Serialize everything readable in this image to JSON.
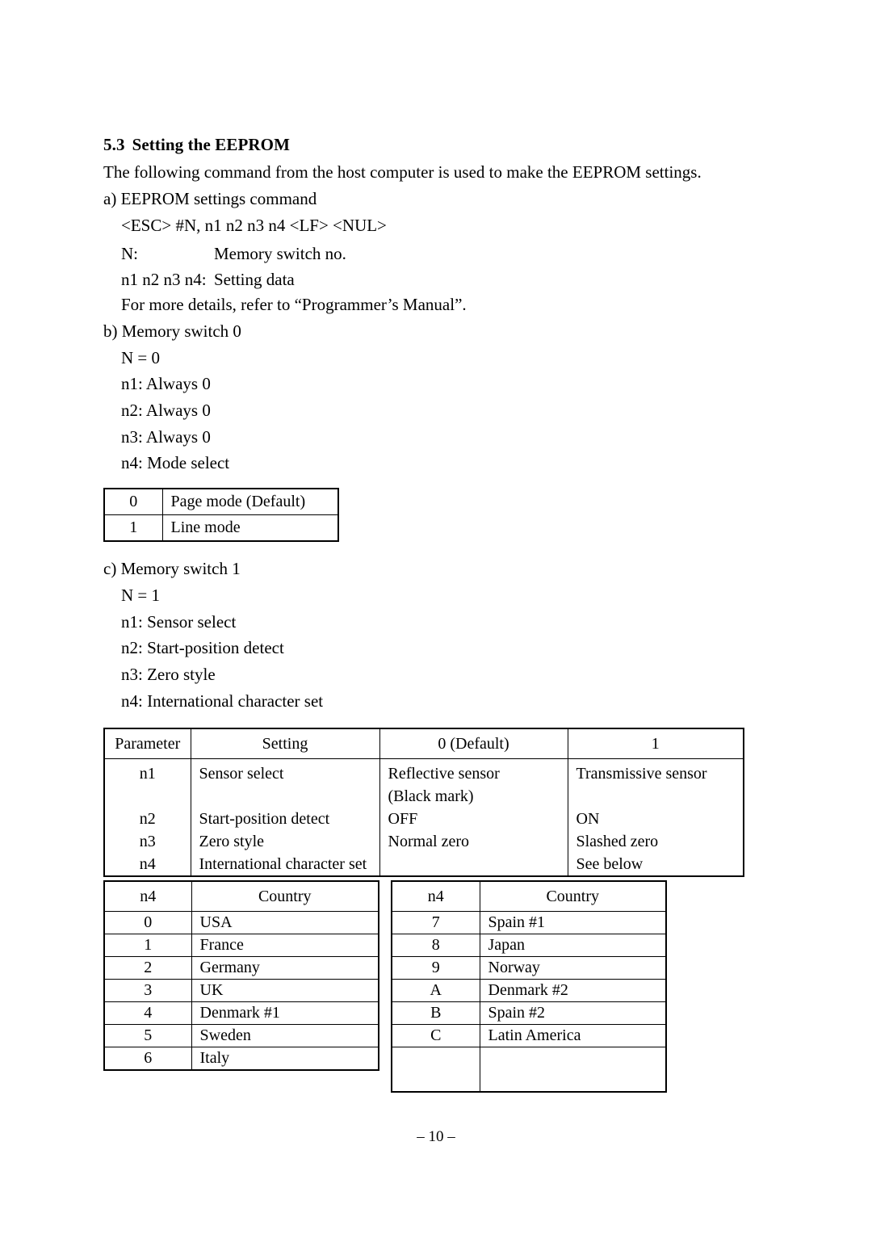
{
  "document": {
    "section_number": "5.3",
    "section_title": "Setting the EEPROM",
    "intro": "The following command from the host computer is used to make the EEPROM settings.",
    "footer": "– 10 –"
  },
  "item_a": {
    "label": "a) EEPROM settings command",
    "command": "<ESC> #N, n1 n2 n3 n4 <LF> <NUL>",
    "def_n_label": "N:",
    "def_n_value": "Memory switch no.",
    "def_data_label": "n1 n2 n3 n4:",
    "def_data_value": "Setting data",
    "note": "For more details, refer to “Programmer’s Manual”."
  },
  "item_b": {
    "label": "b) Memory switch 0",
    "n_equals": "N = 0",
    "lines": [
      "n1: Always 0",
      "n2: Always 0",
      "n3: Always 0",
      "n4: Mode select"
    ]
  },
  "mode_table": {
    "rows": [
      {
        "key": "0",
        "value": "Page mode (Default)"
      },
      {
        "key": "1",
        "value": "Line mode"
      }
    ]
  },
  "item_c": {
    "label": "c) Memory switch 1",
    "n_equals": "N = 1",
    "lines": [
      "n1: Sensor select",
      "n2: Start-position detect",
      "n3: Zero style",
      "n4: International character set"
    ]
  },
  "param_table": {
    "headers": [
      "Parameter",
      "Setting",
      "0 (Default)",
      "1"
    ],
    "rows": [
      {
        "param": [
          "n1",
          ""
        ],
        "setting": [
          "Sensor select",
          ""
        ],
        "default": [
          "Reflective sensor",
          "(Black mark)"
        ],
        "one": [
          "Transmissive sensor",
          ""
        ]
      },
      {
        "param": [
          "n2"
        ],
        "setting": [
          "Start-position detect"
        ],
        "default": [
          "OFF"
        ],
        "one": [
          "ON"
        ]
      },
      {
        "param": [
          "n3"
        ],
        "setting": [
          "Zero style"
        ],
        "default": [
          "Normal zero"
        ],
        "one": [
          "Slashed zero"
        ]
      },
      {
        "param": [
          "n4"
        ],
        "setting": [
          "International character set"
        ],
        "default": [
          ""
        ],
        "one": [
          "See below"
        ]
      }
    ],
    "param_lines": [
      "n1",
      "",
      "n2",
      "n3",
      "n4"
    ],
    "setting_lines": [
      "Sensor select",
      "",
      "Start-position detect",
      "Zero style",
      "International character set"
    ],
    "default_lines": [
      "Reflective sensor",
      "(Black mark)",
      "OFF",
      "Normal zero",
      ""
    ],
    "one_lines": [
      "Transmissive sensor",
      "",
      "ON",
      "Slashed zero",
      "See below"
    ]
  },
  "country_left": {
    "headers": [
      "n4",
      "Country"
    ],
    "rows": [
      {
        "key": "0",
        "value": "USA"
      },
      {
        "key": "1",
        "value": "France"
      },
      {
        "key": "2",
        "value": "Germany"
      },
      {
        "key": "3",
        "value": "UK"
      },
      {
        "key": "4",
        "value": "Denmark #1"
      },
      {
        "key": "5",
        "value": "Sweden"
      },
      {
        "key": "6",
        "value": "Italy"
      }
    ]
  },
  "country_right": {
    "headers": [
      "n4",
      "Country"
    ],
    "rows": [
      {
        "key": "7",
        "value": "Spain #1"
      },
      {
        "key": "8",
        "value": "Japan"
      },
      {
        "key": "9",
        "value": "Norway"
      },
      {
        "key": "A",
        "value": "Denmark #2"
      },
      {
        "key": "B",
        "value": "Spain #2"
      },
      {
        "key": "C",
        "value": "Latin America"
      }
    ]
  }
}
